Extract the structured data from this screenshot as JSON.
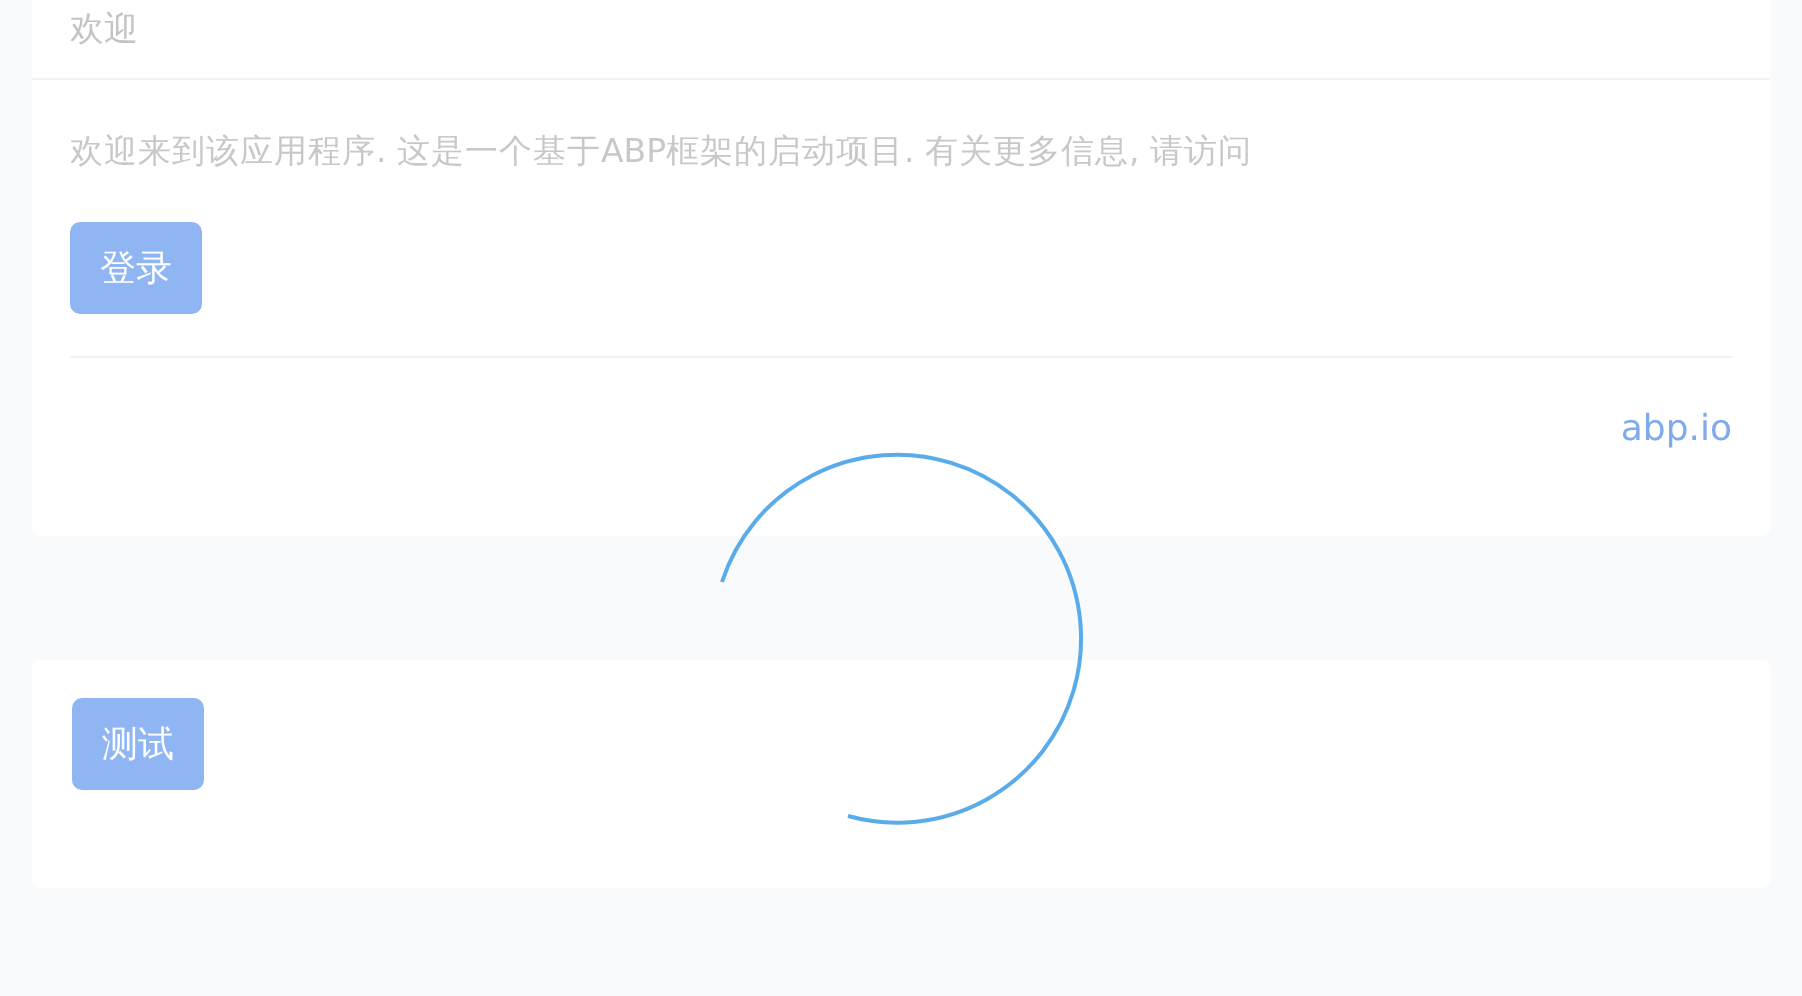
{
  "welcome_card": {
    "title": "欢迎",
    "message": "欢迎来到该应用程序. 这是一个基于ABP框架的启动项目. 有关更多信息, 请访问",
    "login_button": "登录",
    "link": "abp.io"
  },
  "test_card": {
    "button": "测试"
  },
  "loading": true
}
